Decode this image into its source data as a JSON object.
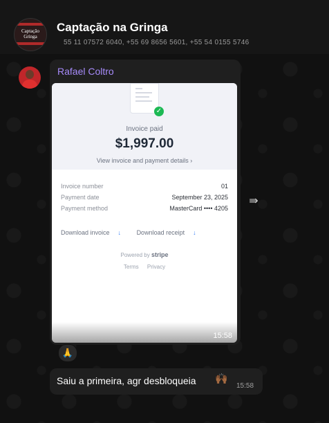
{
  "header": {
    "title": "Captação na Gringa",
    "members": "55 11 07572 6040, +55 69 8656 5601, +55 54 0155 5746",
    "avatar_text": "Captação Gringa"
  },
  "message1": {
    "sender": "Rafael Coltro",
    "time": "15:58",
    "invoice": {
      "status": "Invoice paid",
      "amount": "$1,997.00",
      "view_link": "View invoice and payment details",
      "rows": [
        {
          "label": "Invoice number",
          "value": "01"
        },
        {
          "label": "Payment date",
          "value": "September 23, 2025"
        },
        {
          "label": "Payment method",
          "value": "MasterCard •••• 4205"
        }
      ],
      "download_invoice": "Download invoice",
      "download_receipt": "Download receipt",
      "powered_by": "Powered by",
      "stripe": "stripe",
      "terms": "Terms",
      "privacy": "Privacy"
    },
    "reaction": "🙏"
  },
  "message2": {
    "text": "Saiu a primeira, agr desbloqueia",
    "emoji": "🙌🏾",
    "time": "15:58"
  }
}
